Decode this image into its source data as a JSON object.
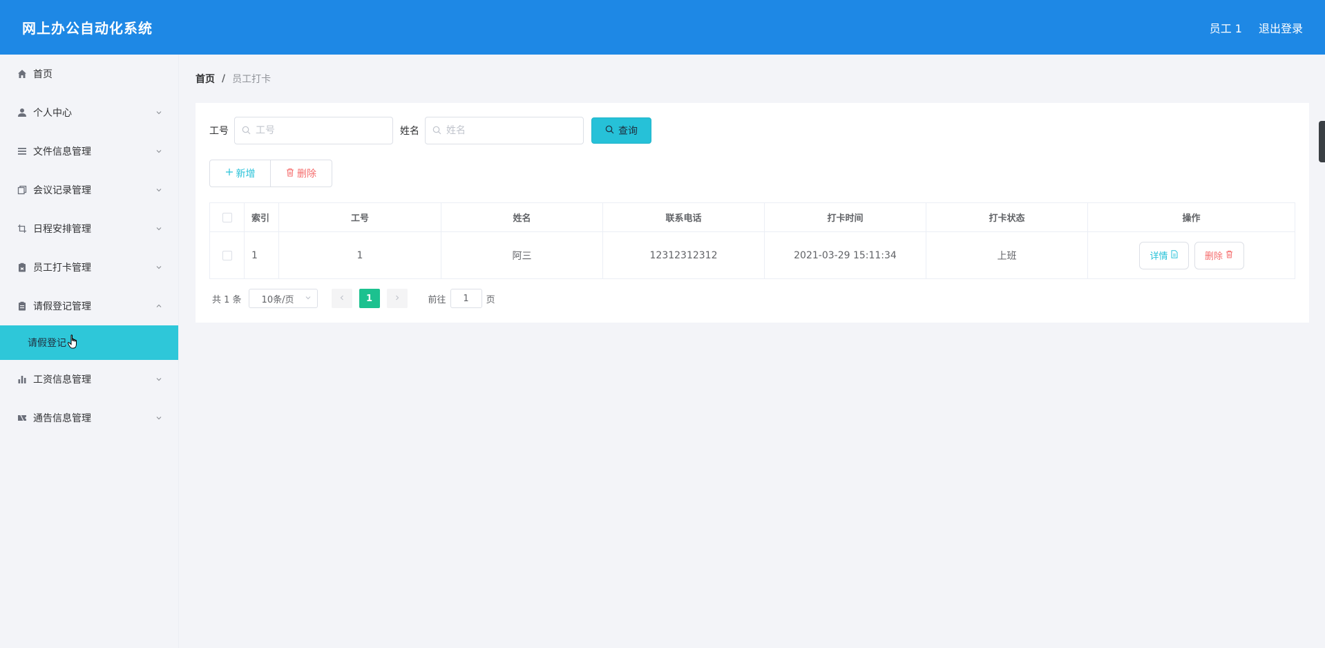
{
  "header": {
    "title": "网上办公自动化系统",
    "user": "员工 1",
    "logout": "退出登录"
  },
  "sidebar": {
    "items": [
      {
        "label": "首页",
        "icon": "home-icon",
        "expandable": false
      },
      {
        "label": "个人中心",
        "icon": "user-icon",
        "expandable": true
      },
      {
        "label": "文件信息管理",
        "icon": "list-icon",
        "expandable": true
      },
      {
        "label": "会议记录管理",
        "icon": "copy-icon",
        "expandable": true
      },
      {
        "label": "日程安排管理",
        "icon": "crop-icon",
        "expandable": true
      },
      {
        "label": "员工打卡管理",
        "icon": "clipboard-icon",
        "expandable": true
      },
      {
        "label": "请假登记管理",
        "icon": "document-icon",
        "expandable": true,
        "expanded": true
      },
      {
        "label": "工资信息管理",
        "icon": "bar-chart-icon",
        "expandable": true
      },
      {
        "label": "通告信息管理",
        "icon": "ticket-icon",
        "expandable": true
      }
    ],
    "active_sub": "请假登记"
  },
  "breadcrumb": {
    "home": "首页",
    "separator": "/",
    "current": "员工打卡"
  },
  "search": {
    "id_label": "工号",
    "id_placeholder": "工号",
    "name_label": "姓名",
    "name_placeholder": "姓名",
    "query_button": "查询"
  },
  "actions": {
    "add": "新增",
    "delete": "删除"
  },
  "table": {
    "headers": [
      "索引",
      "工号",
      "姓名",
      "联系电话",
      "打卡时间",
      "打卡状态",
      "操作"
    ],
    "rows": [
      {
        "index": "1",
        "emp_id": "1",
        "name": "阿三",
        "phone": "12312312312",
        "time": "2021-03-29 15:11:34",
        "status": "上班",
        "detail": "详情",
        "delete": "删除"
      }
    ]
  },
  "pagination": {
    "total": "共 1 条",
    "page_size": "10条/页",
    "current_page": "1",
    "goto_label": "前往",
    "goto_value": "1",
    "page_suffix": "页"
  },
  "colors": {
    "header_bg": "#1e88e5",
    "accent": "#26c1d8",
    "active_page": "#1cc18f",
    "danger": "#f56c6c"
  }
}
